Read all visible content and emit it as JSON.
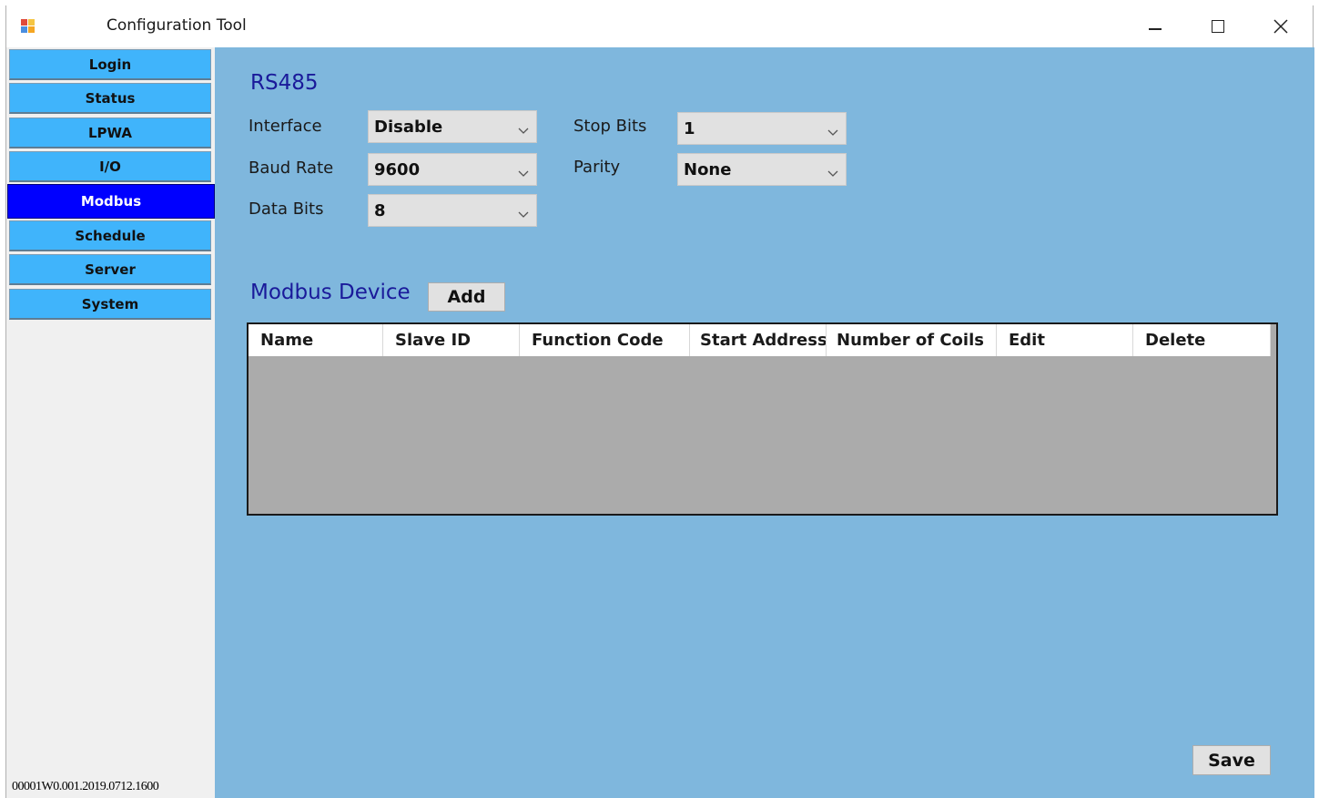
{
  "window": {
    "title": "Configuration Tool",
    "controls": {
      "minimize": "minimize-icon",
      "maximize": "maximize-icon",
      "close": "close-icon"
    }
  },
  "sidebar": {
    "items": [
      {
        "label": "Login"
      },
      {
        "label": "Status"
      },
      {
        "label": "LPWA"
      },
      {
        "label": "I/O"
      },
      {
        "label": "Modbus",
        "active": true
      },
      {
        "label": "Schedule"
      },
      {
        "label": "Server"
      },
      {
        "label": "System"
      }
    ],
    "version": "00001W0.001.2019.0712.1600"
  },
  "rs485": {
    "title": "RS485",
    "interface": {
      "label": "Interface",
      "value": "Disable"
    },
    "baud_rate": {
      "label": "Baud Rate",
      "value": "9600"
    },
    "data_bits": {
      "label": "Data Bits",
      "value": "8"
    },
    "stop_bits": {
      "label": "Stop Bits",
      "value": "1"
    },
    "parity": {
      "label": "Parity",
      "value": "None"
    }
  },
  "modbus_device": {
    "title": "Modbus Device",
    "add_label": "Add",
    "columns": [
      "Name",
      "Slave ID",
      "Function Code",
      "Start Address",
      "Number of Coils",
      "Edit",
      "Delete"
    ],
    "rows": []
  },
  "save_label": "Save",
  "colors": {
    "panel_bg": "#7fb7dd",
    "nav_button": "#40b4fb",
    "nav_active": "#0000ff",
    "section_title": "#1a1a9a"
  }
}
